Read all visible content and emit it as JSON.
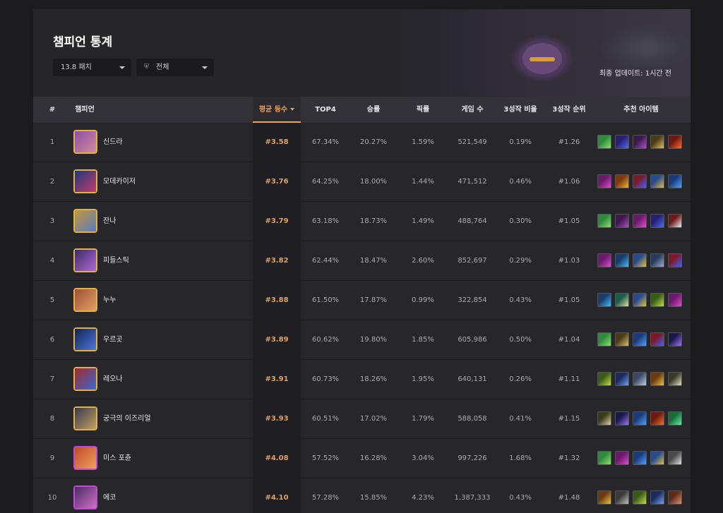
{
  "page": {
    "title": "챔피언 통계",
    "updated": "최종 업데이트: 1시간 전"
  },
  "filters": {
    "patch": "13.8 패치",
    "tier": "전체",
    "tier_icon": "shield-icon"
  },
  "columns": [
    "#",
    "챔피언",
    "평균 등수",
    "TOP4",
    "승률",
    "픽률",
    "게임 수",
    "3성작 비율",
    "3성작 순위",
    "추천 아이템"
  ],
  "sorted_column": "평균 등수",
  "colors": {
    "accent": "#e7a15e",
    "gold_border": "#e3b047",
    "purple_border": "#c04ad6"
  },
  "rows": [
    {
      "rank": "1",
      "name": "신드라",
      "avg": "#3.58",
      "top4": "67.34%",
      "win": "20.27%",
      "pick": "1.59%",
      "games": "521,549",
      "star3_rate": "0.19%",
      "star3_rank": "#1.26",
      "frame": "gold",
      "portrait": [
        "#8c4ea8",
        "#d58a9c"
      ],
      "items": [
        [
          "#2c8a3a",
          "#8fe06a"
        ],
        [
          "#28206e",
          "#4a6cff"
        ],
        [
          "#3b1a4a",
          "#b04ad0"
        ],
        [
          "#4a3a1a",
          "#e0c060"
        ],
        [
          "#6a1a10",
          "#ff6a2a"
        ]
      ]
    },
    {
      "rank": "2",
      "name": "모데카이저",
      "avg": "#3.76",
      "top4": "64.25%",
      "win": "18.00%",
      "pick": "1.44%",
      "games": "471,512",
      "star3_rate": "0.46%",
      "star3_rank": "#1.06",
      "frame": "gold",
      "portrait": [
        "#203a7a",
        "#c23a6a"
      ],
      "items": [
        [
          "#6a1a6a",
          "#e04ad0"
        ],
        [
          "#7a3a10",
          "#ffb030"
        ],
        [
          "#7a1a2a",
          "#4060ff"
        ],
        [
          "#2a4a8a",
          "#e0c040"
        ],
        [
          "#1a3a7a",
          "#50a0ff"
        ]
      ]
    },
    {
      "rank": "3",
      "name": "잔나",
      "avg": "#3.79",
      "top4": "63.18%",
      "win": "18.73%",
      "pick": "1.49%",
      "games": "488,764",
      "star3_rate": "0.30%",
      "star3_rank": "#1.05",
      "frame": "gold",
      "portrait": [
        "#c09a3a",
        "#5a7ac0"
      ],
      "items": [
        [
          "#2c8a3a",
          "#8fe06a"
        ],
        [
          "#3b1a4a",
          "#b04ad0"
        ],
        [
          "#6a1a6a",
          "#e04ad0"
        ],
        [
          "#28206e",
          "#4a6cff"
        ],
        [
          "#6a1a1a",
          "#f0f0f0"
        ]
      ]
    },
    {
      "rank": "4",
      "name": "피들스틱",
      "avg": "#3.82",
      "top4": "62.44%",
      "win": "18.47%",
      "pick": "2.60%",
      "games": "852,697",
      "star3_rate": "0.29%",
      "star3_rank": "#1.03",
      "frame": "gold",
      "portrait": [
        "#3a2a6a",
        "#b06ad0"
      ],
      "items": [
        [
          "#6a1a6a",
          "#e04ad0"
        ],
        [
          "#1a3a6a",
          "#40c0ff"
        ],
        [
          "#2a4a8a",
          "#e0c040"
        ],
        [
          "#2a3a5a",
          "#9ab0d0"
        ],
        [
          "#7a1a2a",
          "#4060ff"
        ]
      ]
    },
    {
      "rank": "5",
      "name": "누누",
      "avg": "#3.88",
      "top4": "61.50%",
      "win": "17.87%",
      "pick": "0.99%",
      "games": "322,854",
      "star3_rate": "0.43%",
      "star3_rank": "#1.05",
      "frame": "gold",
      "portrait": [
        "#a0503a",
        "#e0a060"
      ],
      "items": [
        [
          "#1a3a6a",
          "#40c0ff"
        ],
        [
          "#1a5a4a",
          "#e0e0a0"
        ],
        [
          "#2a4a8a",
          "#e0c040"
        ],
        [
          "#3a5a1a",
          "#c0e040"
        ],
        [
          "#6a1a6a",
          "#e04ad0"
        ]
      ]
    },
    {
      "rank": "6",
      "name": "우르곳",
      "avg": "#3.89",
      "top4": "60.62%",
      "win": "19.80%",
      "pick": "1.85%",
      "games": "605,986",
      "star3_rate": "0.50%",
      "star3_rank": "#1.04",
      "frame": "gold",
      "portrait": [
        "#14204a",
        "#4a7ae0"
      ],
      "items": [
        [
          "#2c8a3a",
          "#8fe06a"
        ],
        [
          "#4a3a1a",
          "#e0c060"
        ],
        [
          "#1a3a7a",
          "#50a0ff"
        ],
        [
          "#7a1a2a",
          "#4060ff"
        ],
        [
          "#1a1a4a",
          "#a070ff"
        ]
      ]
    },
    {
      "rank": "7",
      "name": "레오나",
      "avg": "#3.91",
      "top4": "60.73%",
      "win": "18.26%",
      "pick": "1.95%",
      "games": "640,131",
      "star3_rate": "0.26%",
      "star3_rank": "#1.11",
      "frame": "gold",
      "portrait": [
        "#a02a2a",
        "#3a6ad0"
      ],
      "items": [
        [
          "#3a5a1a",
          "#c0e040"
        ],
        [
          "#1a2a5a",
          "#70a0ff"
        ],
        [
          "#3a4a6a",
          "#c0d0e0"
        ],
        [
          "#6a3a10",
          "#f0c040"
        ],
        [
          "#3a3a2a",
          "#e0e0c0"
        ]
      ]
    },
    {
      "rank": "8",
      "name": "궁극의 이즈리얼",
      "avg": "#3.93",
      "top4": "60.51%",
      "win": "17.02%",
      "pick": "1.79%",
      "games": "588,058",
      "star3_rate": "0.41%",
      "star3_rank": "#1.15",
      "frame": "gold",
      "portrait": [
        "#3a3a4a",
        "#c0a060"
      ],
      "items": [
        [
          "#3a3a1a",
          "#e0d0a0"
        ],
        [
          "#1a1a4a",
          "#a070ff"
        ],
        [
          "#1a3a7a",
          "#50a0ff"
        ],
        [
          "#6a1a10",
          "#ff6a2a"
        ],
        [
          "#1a6a3a",
          "#60f0a0"
        ]
      ]
    },
    {
      "rank": "9",
      "name": "미스 포츈",
      "avg": "#4.08",
      "top4": "57.52%",
      "win": "16.28%",
      "pick": "3.04%",
      "games": "997,226",
      "star3_rate": "1.68%",
      "star3_rank": "#1.32",
      "frame": "purple",
      "portrait": [
        "#c04a2a",
        "#f0a060"
      ],
      "items": [
        [
          "#2c8a3a",
          "#8fe06a"
        ],
        [
          "#6a1a6a",
          "#e04ad0"
        ],
        [
          "#1a3a7a",
          "#50a0ff"
        ],
        [
          "#2a4a8a",
          "#e0c040"
        ],
        [
          "#4a4a4a",
          "#e0e0e0"
        ]
      ]
    },
    {
      "rank": "10",
      "name": "에코",
      "avg": "#4.10",
      "top4": "57.28%",
      "win": "15.85%",
      "pick": "4.23%",
      "games": "1,387,333",
      "star3_rate": "0.43%",
      "star3_rank": "#1.48",
      "frame": "purple",
      "portrait": [
        "#4a2a6a",
        "#d070c0"
      ],
      "items": [
        [
          "#6a3a10",
          "#f0c040"
        ],
        [
          "#3a3a3a",
          "#c0c0c0"
        ],
        [
          "#3a5a1a",
          "#c0e040"
        ],
        [
          "#1a2a5a",
          "#70a0ff"
        ],
        [
          "#5a2a1a",
          "#e09070"
        ]
      ]
    }
  ]
}
